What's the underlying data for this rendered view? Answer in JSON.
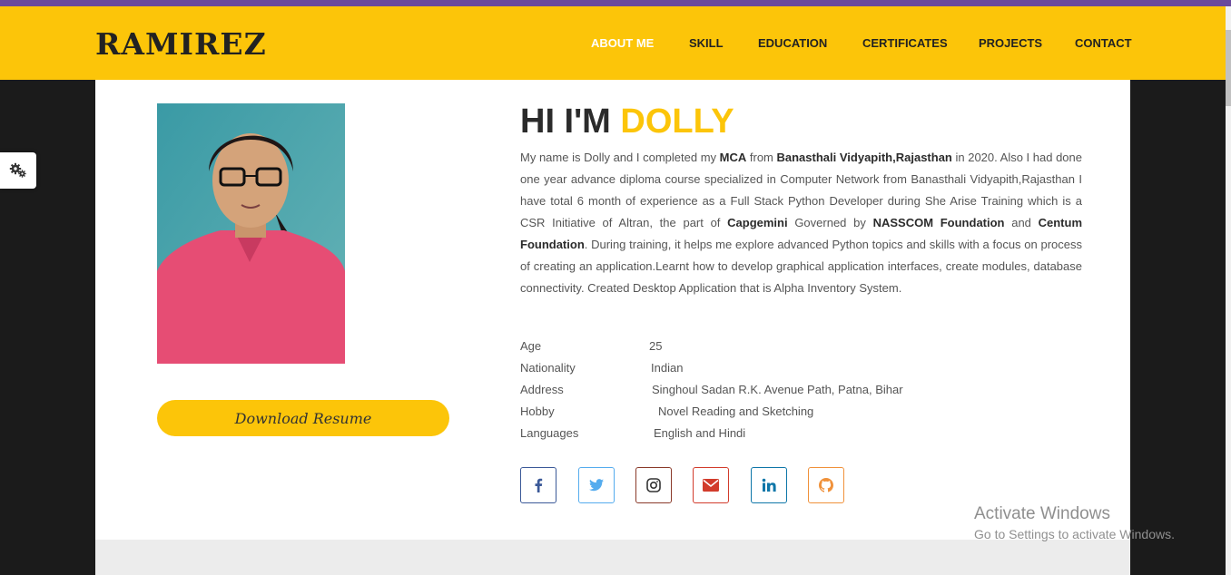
{
  "brand": "RAMIREZ",
  "nav": [
    {
      "label": "ABOUT ME",
      "active": true
    },
    {
      "label": "SKILL"
    },
    {
      "label": "EDUCATION"
    },
    {
      "label": "CERTIFICATES"
    },
    {
      "label": "PROJECTS"
    },
    {
      "label": "CONTACT"
    }
  ],
  "settings": {
    "icon": "gears-icon"
  },
  "download": {
    "label": "Download Resume"
  },
  "hero": {
    "greeting": "HI I'M",
    "name": "DOLLY"
  },
  "bio": {
    "parts": [
      {
        "text": "My name is Dolly and I completed my "
      },
      {
        "text": "MCA",
        "bold": true
      },
      {
        "text": " from "
      },
      {
        "text": "Banasthali Vidyapith,Rajasthan",
        "bold": true
      },
      {
        "text": " in 2020. Also I had done one year advance diploma course specialized in Computer Network from Banasthali Vidyapith,Rajasthan I have total 6 month of experience as a Full Stack Python Developer during She Arise Training which is a CSR Initiative of Altran, the part of "
      },
      {
        "text": "Capgemini",
        "bold": true
      },
      {
        "text": " Governed by "
      },
      {
        "text": "NASSCOM Foundation",
        "bold": true
      },
      {
        "text": " and "
      },
      {
        "text": "Centum Foundation",
        "bold": true
      },
      {
        "text": ". During training, it helps me explore advanced Python topics and skills with a focus on process of creating an application.Learnt how to develop graphical application interfaces, create modules, database connectivity. Created Desktop Application that is Alpha Inventory System."
      }
    ]
  },
  "info": [
    {
      "label": "Age",
      "value": "25"
    },
    {
      "label": "Nationality",
      "value": "Indian"
    },
    {
      "label": "Address",
      "value": "Singhoul Sadan R.K. Avenue Path, Patna, Bihar"
    },
    {
      "label": "Hobby",
      "value": "Novel Reading and Sketching"
    },
    {
      "label": "Languages",
      "value": "English and Hindi"
    }
  ],
  "social": [
    {
      "name": "facebook",
      "icon": "facebook-icon",
      "color": "#3b5998"
    },
    {
      "name": "twitter",
      "icon": "twitter-icon",
      "color": "#55acee"
    },
    {
      "name": "instagram",
      "icon": "instagram-icon",
      "color": "#8a3a2a"
    },
    {
      "name": "email",
      "icon": "envelope-icon",
      "color": "#d23c2c"
    },
    {
      "name": "linkedin",
      "icon": "linkedin-icon",
      "color": "#0e76a8"
    },
    {
      "name": "github",
      "icon": "github-icon",
      "color": "#f0913a"
    }
  ],
  "watermark": {
    "title": "Activate Windows",
    "subtitle": "Go to Settings to activate Windows."
  },
  "colors": {
    "accent": "#fcc509",
    "topStrip": "#6a4a9c",
    "text": "#555555",
    "heading": "#2b2b2b"
  }
}
